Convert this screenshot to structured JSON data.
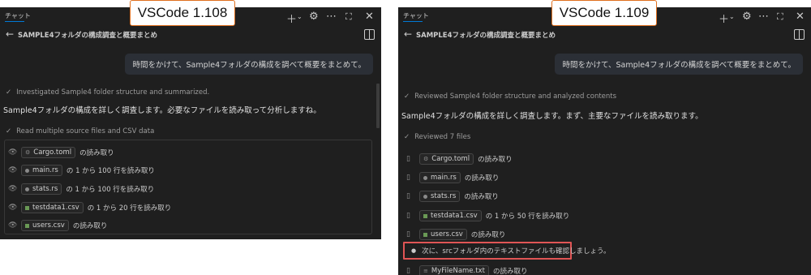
{
  "labels": {
    "left_version": "VSCode 1.108",
    "right_version": "VSCode 1.109"
  },
  "left": {
    "tab_label": "チャット",
    "title": "SAMPLE4フォルダの構成調査と概要まとめ",
    "user_message": "時間をかけて、Sample4フォルダの構成を調べて概要をまとめて。",
    "progress_status": "Investigated Sample4 folder structure and summarized.",
    "response_text": "Sample4フォルダの構成を詳しく調査します。必要なファイルを読み取って分析しますね。",
    "read_status": "Read multiple source files and CSV data",
    "files": [
      {
        "name": "Cargo.toml",
        "suffix": "の読み取り"
      },
      {
        "name": "main.rs",
        "suffix": "の 1 から 100 行を読み取り"
      },
      {
        "name": "stats.rs",
        "suffix": "の 1 から 100 行を読み取り"
      },
      {
        "name": "testdata1.csv",
        "suffix": "の 1 から 20 行を読み取り"
      },
      {
        "name": "users.csv",
        "suffix": "の読み取り"
      }
    ]
  },
  "right": {
    "tab_label": "チャット",
    "title": "SAMPLE4フォルダの構成調査と概要まとめ",
    "user_message": "時間をかけて、Sample4フォルダの構成を調べて概要をまとめて。",
    "progress_status": "Reviewed Sample4 folder structure and analyzed contents",
    "response_text": "Sample4フォルダの構成を詳しく調査します。まず、主要なファイルを読み取ります。",
    "read_status": "Reviewed 7 files",
    "files": [
      {
        "name": "Cargo.toml",
        "suffix": "の読み取り"
      },
      {
        "name": "main.rs",
        "suffix": "の読み取り"
      },
      {
        "name": "stats.rs",
        "suffix": "の読み取り"
      },
      {
        "name": "testdata1.csv",
        "suffix": "の 1 から 50 行を読み取り"
      },
      {
        "name": "users.csv",
        "suffix": "の読み取り"
      }
    ],
    "next_step": "次に、srcフォルダ内のテキストファイルも確認しましょう。",
    "last_file": {
      "name": "MyFileName.txt",
      "suffix": "の読み取り"
    }
  },
  "icons": {
    "plus": "plus-icon",
    "chevron": "chevron-down-icon",
    "settings": "gear-icon",
    "more": "more-icon",
    "maximize": "maximize-icon",
    "close": "close-icon",
    "back": "back-arrow-icon",
    "sidebar": "sidebar-toggle-icon",
    "check": "check-icon",
    "eye": "eye-icon",
    "book": "book-icon"
  },
  "colors": {
    "panel_bg": "#1f1f1f",
    "bubble_bg": "#2b2f36",
    "highlight_border": "#e05555",
    "label_border": "#e0701f",
    "csv_icon": "#6a9955"
  }
}
